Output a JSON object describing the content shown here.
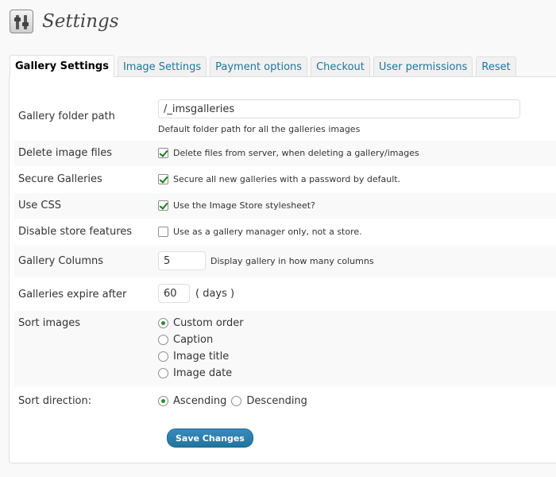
{
  "page": {
    "title": "Settings"
  },
  "tabs": [
    {
      "label": "Gallery Settings",
      "active": true
    },
    {
      "label": "Image Settings"
    },
    {
      "label": "Payment options"
    },
    {
      "label": "Checkout"
    },
    {
      "label": "User permissions"
    },
    {
      "label": "Reset"
    }
  ],
  "form": {
    "gallery_folder": {
      "label": "Gallery folder path",
      "value": "/_imsgalleries",
      "description": "Default folder path for all the galleries images"
    },
    "delete_files": {
      "label": "Delete image files",
      "checked": true,
      "checkbox_label": "Delete files from server, when deleting a gallery/images"
    },
    "secure_galleries": {
      "label": "Secure Galleries",
      "checked": true,
      "checkbox_label": "Secure all new galleries with a password by default."
    },
    "use_css": {
      "label": "Use CSS",
      "checked": true,
      "checkbox_label": "Use the Image Store stylesheet?"
    },
    "disable_store": {
      "label": "Disable store features",
      "checked": false,
      "checkbox_label": "Use as a gallery manager only, not a store."
    },
    "gallery_columns": {
      "label": "Gallery Columns",
      "value": "5",
      "description": "Display gallery in how many columns"
    },
    "galleries_expire": {
      "label": "Galleries expire after",
      "value": "60",
      "unit": "( days )"
    },
    "sort_images": {
      "label": "Sort images",
      "options": [
        "Custom order",
        "Caption",
        "Image title",
        "Image date"
      ],
      "selected": "Custom order"
    },
    "sort_direction": {
      "label": "Sort direction:",
      "options": [
        "Ascending",
        "Descending"
      ],
      "selected": "Ascending"
    }
  },
  "actions": {
    "save_label": "Save Changes"
  },
  "colors": {
    "link": "#21759b",
    "button": "#21759b",
    "check": "#1a7b1a"
  }
}
